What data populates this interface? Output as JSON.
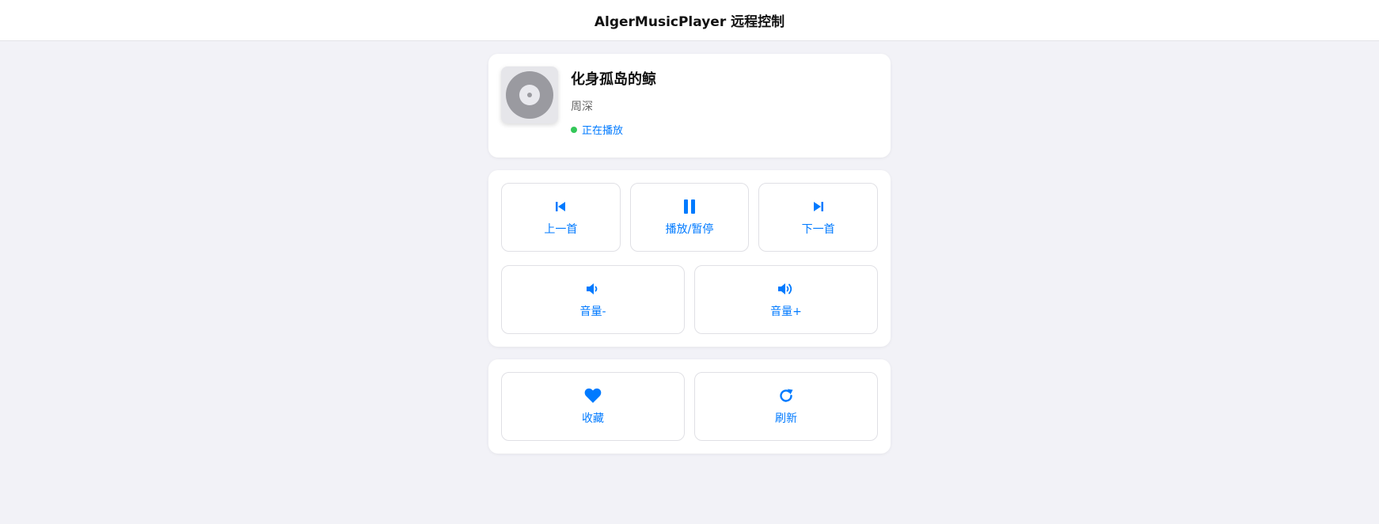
{
  "app": {
    "title": "AlgerMusicPlayer 远程控制"
  },
  "now_playing": {
    "song": "化身孤岛的鲸",
    "artist": "周深",
    "status": "正在播放",
    "status_color": "#34c759"
  },
  "controls": {
    "prev": {
      "label": "上一首",
      "icon": "skip-back-icon"
    },
    "play_pause": {
      "label": "播放/暂停",
      "icon": "pause-icon"
    },
    "next": {
      "label": "下一首",
      "icon": "skip-forward-icon"
    },
    "volume_down": {
      "label": "音量-",
      "icon": "volume-down-icon"
    },
    "volume_up": {
      "label": "音量+",
      "icon": "volume-up-icon"
    }
  },
  "actions": {
    "favorite": {
      "label": "收藏",
      "icon": "heart-icon"
    },
    "refresh": {
      "label": "刷新",
      "icon": "refresh-icon"
    }
  },
  "colors": {
    "accent": "#007aff",
    "background": "#f2f2f7"
  }
}
